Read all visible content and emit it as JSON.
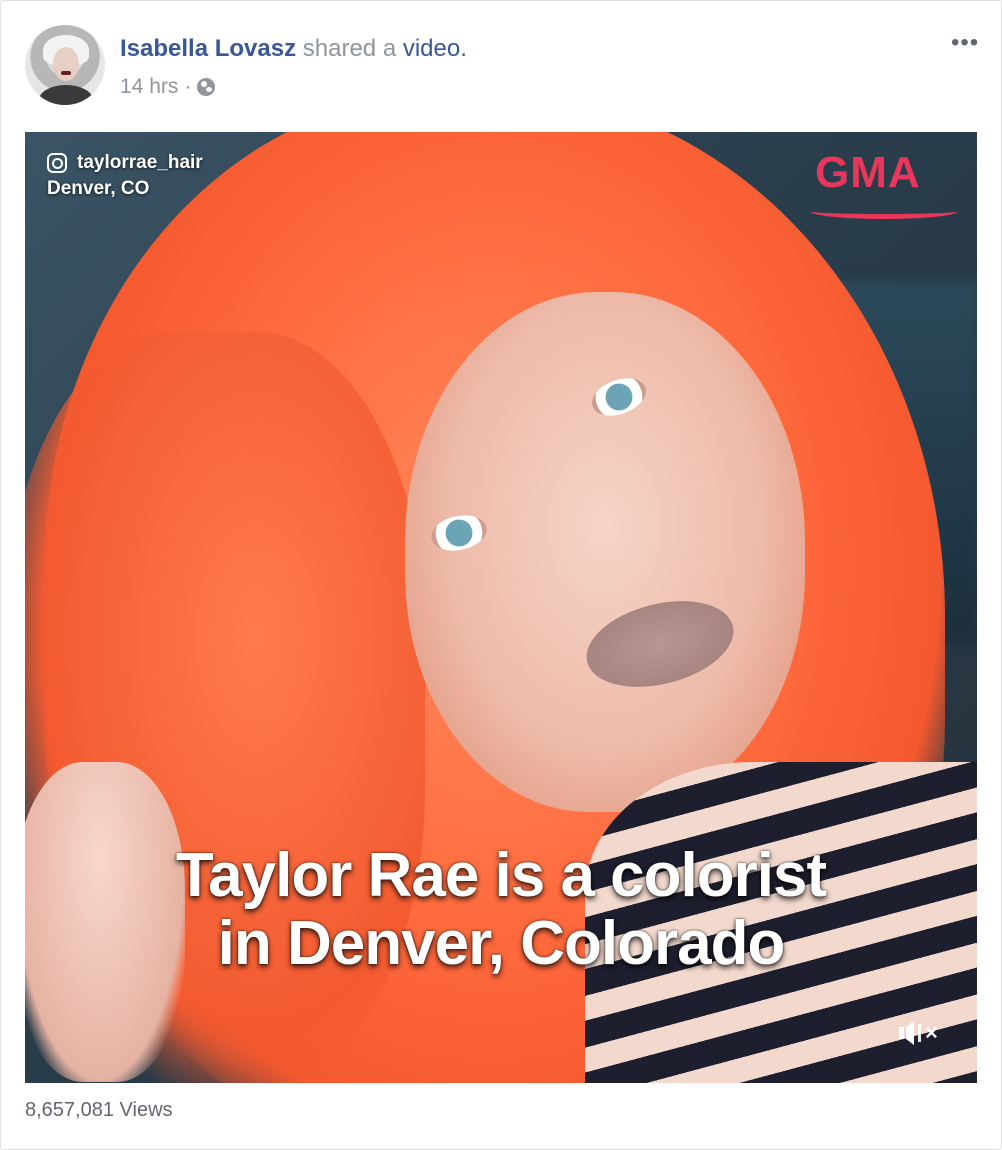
{
  "post": {
    "author": "Isabella Lovasz",
    "action_text": "shared a",
    "object_link": "video.",
    "time": "14 hrs",
    "separator": "·",
    "privacy_icon": "globe-icon",
    "more_label": "•••"
  },
  "video": {
    "ig_handle": "taylorrae_hair",
    "location": "Denver, CO",
    "brand": "GMA",
    "caption_line1": "Taylor Rae is a colorist",
    "caption_line2": "in Denver, Colorado",
    "mute_icon": "speaker-muted-icon",
    "mute_label": "×"
  },
  "footer": {
    "views": "8,657,081 Views"
  },
  "colors": {
    "link": "#385898",
    "meta": "#90949c",
    "brand": "#e8365d"
  }
}
